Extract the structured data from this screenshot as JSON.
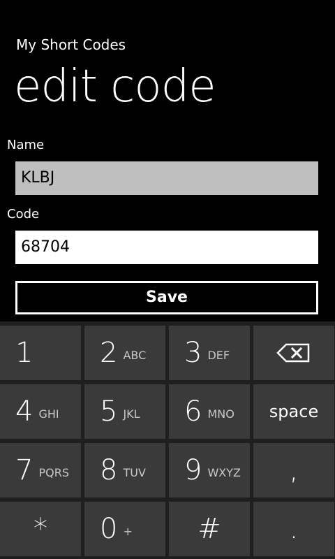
{
  "header": {
    "app_title": "My Short Codes",
    "page_title": "edit code"
  },
  "form": {
    "name_label": "Name",
    "name_value": "KLBJ",
    "code_label": "Code",
    "code_value": "68704",
    "save_label": "Save"
  },
  "keypad": {
    "keys": [
      {
        "main": "1",
        "sub": ""
      },
      {
        "main": "2",
        "sub": "ABC"
      },
      {
        "main": "3",
        "sub": "DEF"
      },
      {
        "icon": "backspace-icon"
      },
      {
        "main": "4",
        "sub": "GHI"
      },
      {
        "main": "5",
        "sub": "JKL"
      },
      {
        "main": "6",
        "sub": "MNO"
      },
      {
        "main": "space"
      },
      {
        "main": "7",
        "sub": "PQRS"
      },
      {
        "main": "8",
        "sub": "TUV"
      },
      {
        "main": "9",
        "sub": "WXYZ"
      },
      {
        "main": ","
      },
      {
        "main": "*"
      },
      {
        "main": "0",
        "sub": "+"
      },
      {
        "main": "#"
      },
      {
        "main": "."
      }
    ]
  },
  "colors": {
    "background": "#000000",
    "keyboard_background": "#1f1f1f",
    "key_background": "#3a3a3a",
    "name_field_background": "#bfbfbf",
    "code_field_background": "#ffffff"
  }
}
